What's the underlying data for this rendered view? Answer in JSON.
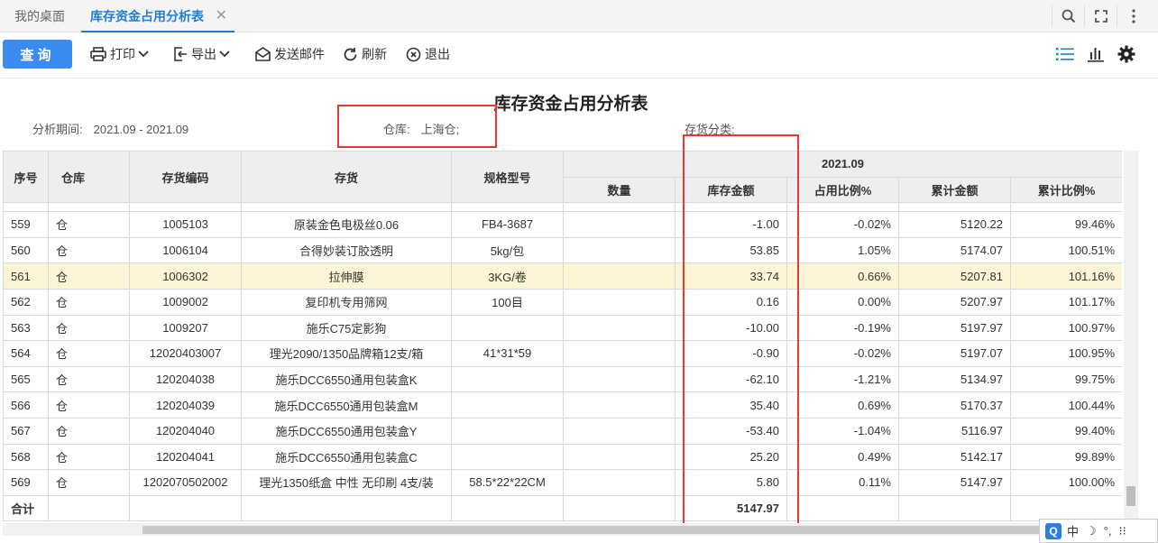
{
  "tabs": {
    "home": "我的桌面",
    "active": "库存资金占用分析表",
    "close": "✕"
  },
  "toolbar": {
    "query": "查询",
    "print": "打印",
    "export": "导出",
    "send_mail": "发送邮件",
    "refresh": "刷新",
    "exit": "退出"
  },
  "report": {
    "title": "库存资金占用分析表",
    "period_label": "分析期间:",
    "period_value": "2021.09 - 2021.09",
    "warehouse_label": "仓库:",
    "warehouse_value": "上海仓;",
    "category_label": "存货分类:"
  },
  "table": {
    "headers": {
      "seq": "序号",
      "warehouse": "仓库",
      "code": "存货编码",
      "item": "存货",
      "spec": "规格型号",
      "period": "2021.09",
      "qty": "数量",
      "amount": "库存金额",
      "ratio": "占用比例%",
      "cum_amount": "累计金额",
      "cum_ratio": "累计比例%"
    },
    "rows": [
      {
        "seq": "559",
        "wh": "仓",
        "code": "1005103",
        "item": "原装金色电极丝0.06",
        "spec": "FB4-3687",
        "qty": "",
        "amount": "-1.00",
        "ratio": "-0.02%",
        "cum": "5120.22",
        "cumr": "99.46%",
        "neg": true
      },
      {
        "seq": "560",
        "wh": "仓",
        "code": "1006104",
        "item": "合得妙装订胶透明",
        "spec": "5kg/包",
        "qty": "",
        "amount": "53.85",
        "ratio": "1.05%",
        "cum": "5174.07",
        "cumr": "100.51%",
        "neg": false
      },
      {
        "seq": "561",
        "wh": "仓",
        "code": "1006302",
        "item": "拉伸膜",
        "spec": "3KG/卷",
        "qty": "",
        "amount": "33.74",
        "ratio": "0.66%",
        "cum": "5207.81",
        "cumr": "101.16%",
        "neg": false,
        "hl": true
      },
      {
        "seq": "562",
        "wh": "仓",
        "code": "1009002",
        "item": "复印机专用筛网",
        "spec": "100目",
        "qty": "",
        "amount": "0.16",
        "ratio": "0.00%",
        "cum": "5207.97",
        "cumr": "101.17%",
        "neg": false
      },
      {
        "seq": "563",
        "wh": "仓",
        "code": "1009207",
        "item": "施乐C75定影狗",
        "spec": "",
        "qty": "",
        "amount": "-10.00",
        "ratio": "-0.19%",
        "cum": "5197.97",
        "cumr": "100.97%",
        "neg": true
      },
      {
        "seq": "564",
        "wh": "仓",
        "code": "12020403007",
        "item": "理光2090/1350品牌箱12支/箱",
        "spec": "41*31*59",
        "qty": "",
        "amount": "-0.90",
        "ratio": "-0.02%",
        "cum": "5197.07",
        "cumr": "100.95%",
        "neg": true
      },
      {
        "seq": "565",
        "wh": "仓",
        "code": "120204038",
        "item": "施乐DCC6550通用包装盒K",
        "spec": "",
        "qty": "",
        "amount": "-62.10",
        "ratio": "-1.21%",
        "cum": "5134.97",
        "cumr": "99.75%",
        "neg": true
      },
      {
        "seq": "566",
        "wh": "仓",
        "code": "120204039",
        "item": "施乐DCC6550通用包装盒M",
        "spec": "",
        "qty": "",
        "amount": "35.40",
        "ratio": "0.69%",
        "cum": "5170.37",
        "cumr": "100.44%",
        "neg": false
      },
      {
        "seq": "567",
        "wh": "仓",
        "code": "120204040",
        "item": "施乐DCC6550通用包装盒Y",
        "spec": "",
        "qty": "",
        "amount": "-53.40",
        "ratio": "-1.04%",
        "cum": "5116.97",
        "cumr": "99.40%",
        "neg": true
      },
      {
        "seq": "568",
        "wh": "仓",
        "code": "120204041",
        "item": "施乐DCC6550通用包装盒C",
        "spec": "",
        "qty": "",
        "amount": "25.20",
        "ratio": "0.49%",
        "cum": "5142.17",
        "cumr": "99.89%",
        "neg": false
      },
      {
        "seq": "569",
        "wh": "仓",
        "code": "1202070502002",
        "item": "理光1350纸盒 中性 无印刷 4支/装",
        "spec": "58.5*22*22CM",
        "qty": "",
        "amount": "5.80",
        "ratio": "0.11%",
        "cum": "5147.97",
        "cumr": "100.00%",
        "neg": false
      }
    ],
    "total_label": "合计",
    "total_amount": "5147.97"
  },
  "ime": {
    "logo": "Q",
    "lang": "中",
    "moon": "☽",
    "punct": "°,",
    "more": "⁝⁝"
  },
  "colors": {
    "accent": "#1f7ed0",
    "button": "#3b8cf0",
    "negative": "#e53935",
    "highlight_row": "#fdf5d6"
  }
}
